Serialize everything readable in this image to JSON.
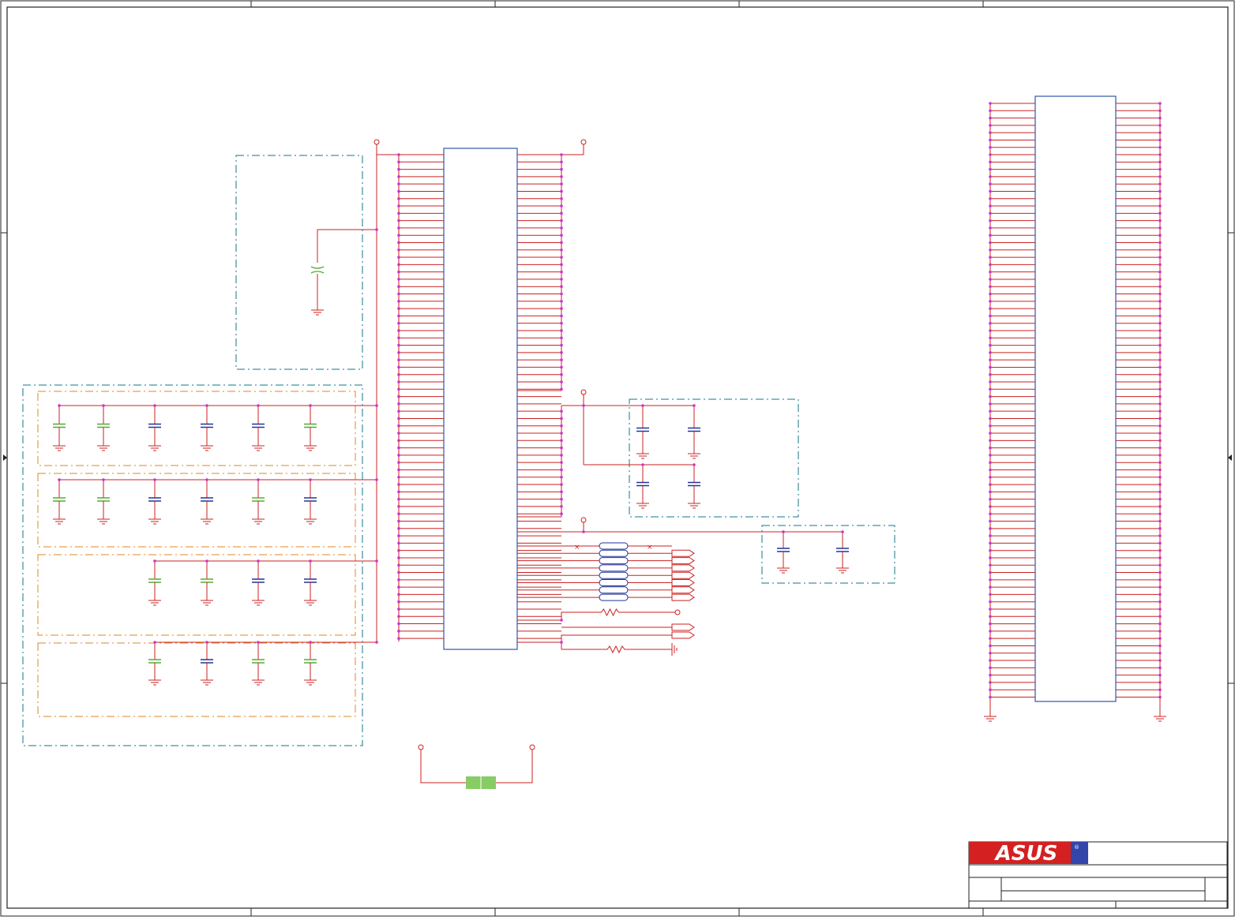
{
  "title_block": {
    "logo_text": "ASUS",
    "registered_mark": "®"
  },
  "colors": {
    "border": "#222222",
    "wire": "#cc2222",
    "net_dot": "#cc33cc",
    "ic_body": "#3355aa",
    "cap_green": "#55aa33",
    "cap_blue": "#223399",
    "dash_teal": "#117788",
    "dash_orange": "#dd8822",
    "gnd": "#cc2222",
    "ferrite": "#88cc66",
    "logo_red": "#d42020",
    "logo_blue": "#3344aa"
  },
  "icons": [
    "ground-symbol",
    "power-port-circle",
    "capacitor-symbol",
    "resistor-symbol",
    "off-page-connector",
    "no-connect-mark"
  ]
}
